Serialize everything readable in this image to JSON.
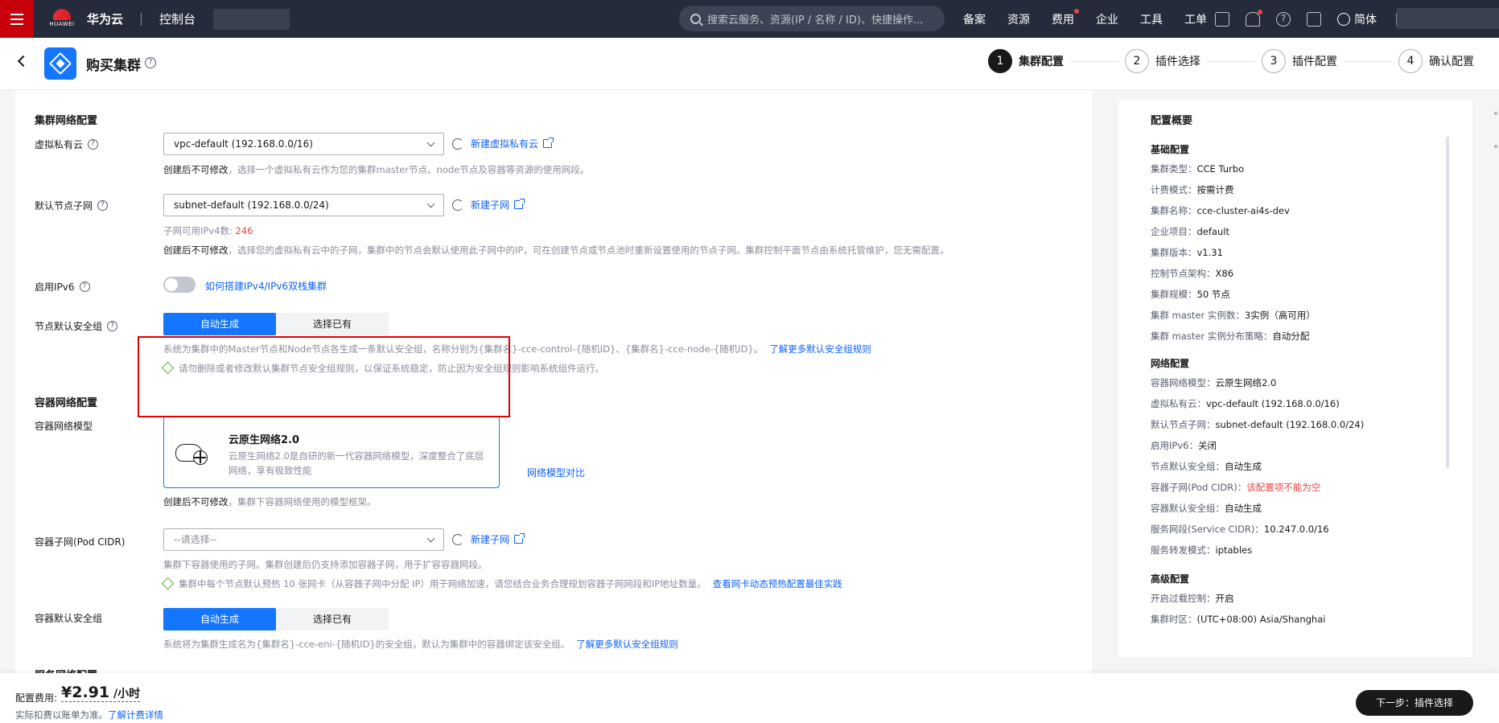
{
  "topbar": {
    "brand": "华为云",
    "logo_sub": "HUAWEI",
    "console": "控制台",
    "search_placeholder": "搜索云服务、资源(IP / 名称 / ID)、快捷操作...",
    "nav": [
      "备案",
      "资源",
      "费用",
      "企业",
      "工具",
      "工单"
    ],
    "lang": "简体"
  },
  "header": {
    "title": "购买集群",
    "steps": [
      {
        "num": "1",
        "label": "集群配置"
      },
      {
        "num": "2",
        "label": "插件选择"
      },
      {
        "num": "3",
        "label": "插件配置"
      },
      {
        "num": "4",
        "label": "确认配置"
      }
    ]
  },
  "form": {
    "cluster_network_title": "集群网络配置",
    "vpc_label": "虚拟私有云",
    "vpc_value": "vpc-default (192.168.0.0/16)",
    "vpc_link": "新建虚拟私有云",
    "vpc_hint_bold": "创建后不可修改",
    "vpc_hint": "，选择一个虚拟私有云作为您的集群master节点、node节点及容器等资源的使用网段。",
    "subnet_label": "默认节点子网",
    "subnet_value": "subnet-default (192.168.0.0/24)",
    "subnet_link": "新建子网",
    "subnet_ip_label": "子网可用IPv4数: ",
    "subnet_ip_count": "246",
    "subnet_hint_bold": "创建后不可修改",
    "subnet_hint": "，选择您的虚拟私有云中的子网，集群中的节点会默认使用此子网中的IP，可在创建节点或节点池时重新设置使用的节点子网。集群控制平面节点由系统托管维护，您无需配置。",
    "ipv6_label": "启用IPv6",
    "ipv6_link": "如何搭建IPv4/IPv6双栈集群",
    "node_sg_label": "节点默认安全组",
    "seg_auto": "自动生成",
    "seg_existing": "选择已有",
    "node_sg_hint": "系统为集群中的Master节点和Node节点各生成一条默认安全组，名称分别为{集群名}-cce-control-{随机ID}、{集群名}-cce-node-{随机ID}。",
    "node_sg_hint_link": "了解更多默认安全组规则",
    "node_sg_warn": "请勿删除或者修改默认集群节点安全组规则，以保证系统稳定，防止因为安全组规则影响系统组件运行。",
    "container_network_title": "容器网络配置",
    "model_label": "容器网络模型",
    "card_title": "云原生网络2.0",
    "card_desc": "云原生网络2.0是自研的新一代容器网络模型，深度整合了底层网络，享有极致性能",
    "model_compare_link": "网络模型对比",
    "model_hint_bold": "创建后不可修改",
    "model_hint": "，集群下容器网络使用的模型框架。",
    "pod_cidr_label": "容器子网(Pod CIDR)",
    "pod_cidr_placeholder": "--请选择--",
    "pod_cidr_link": "新建子网",
    "pod_cidr_hint": "集群下容器使用的子网。集群创建后仍支持添加容器子网，用于扩容容器网段。",
    "pod_cidr_warn": "集群中每个节点默认预热 10 张网卡（从容器子网中分配 IP）用于网络加速，请您结合业务合理规划容器子网网段和IP地址数量。",
    "pod_cidr_warn_link": "查看网卡动态预热配置最佳实践",
    "container_sg_label": "容器默认安全组",
    "container_sg_hint": "系统将为集群生成名为{集群名}-cce-eni-{随机ID}的安全组，默认为集群中的容器绑定该安全组。",
    "container_sg_hint_link": "了解更多默认安全组规则",
    "service_network_title": "服务网络配置"
  },
  "summary": {
    "title": "配置概要",
    "basic_title": "基础配置",
    "basic": [
      {
        "k": "集群类型：",
        "v": "CCE Turbo"
      },
      {
        "k": "计费模式：",
        "v": "按需计费"
      },
      {
        "k": "集群名称：",
        "v": "cce-cluster-ai4s-dev"
      },
      {
        "k": "企业项目：",
        "v": "default"
      },
      {
        "k": "集群版本：",
        "v": "v1.31"
      },
      {
        "k": "控制节点架构：",
        "v": "X86"
      },
      {
        "k": "集群规模：",
        "v": "50 节点"
      },
      {
        "k": "集群 master 实例数：",
        "v": "3实例（高可用）"
      },
      {
        "k": "集群 master 实例分布策略：",
        "v": "自动分配"
      }
    ],
    "network_title": "网络配置",
    "network": [
      {
        "k": "容器网络模型：",
        "v": "云原生网络2.0"
      },
      {
        "k": "虚拟私有云：",
        "v": "vpc-default (192.168.0.0/16)"
      },
      {
        "k": "默认节点子网：",
        "v": "subnet-default (192.168.0.0/24)"
      },
      {
        "k": "启用IPv6：",
        "v": "关闭"
      },
      {
        "k": "节点默认安全组：",
        "v": "自动生成"
      },
      {
        "k": "容器子网(Pod CIDR)：",
        "v": "该配置项不能为空"
      },
      {
        "k": "容器默认安全组：",
        "v": "自动生成"
      },
      {
        "k": "服务网段(Service CIDR)：",
        "v": "10.247.0.0/16"
      },
      {
        "k": "服务转发模式：",
        "v": "iptables"
      }
    ],
    "advanced_title": "高级配置",
    "advanced": [
      {
        "k": "开启过载控制：",
        "v": "开启"
      },
      {
        "k": "集群时区：",
        "v": "(UTC+08:00) Asia/Shanghai"
      }
    ]
  },
  "bottom": {
    "fee_label": "配置费用:",
    "fee_value": "¥2.91",
    "fee_unit": " /小时",
    "note": "实际扣费以账单为准。",
    "note_link": "了解计费详情",
    "next_button": "下一步：插件选择"
  }
}
